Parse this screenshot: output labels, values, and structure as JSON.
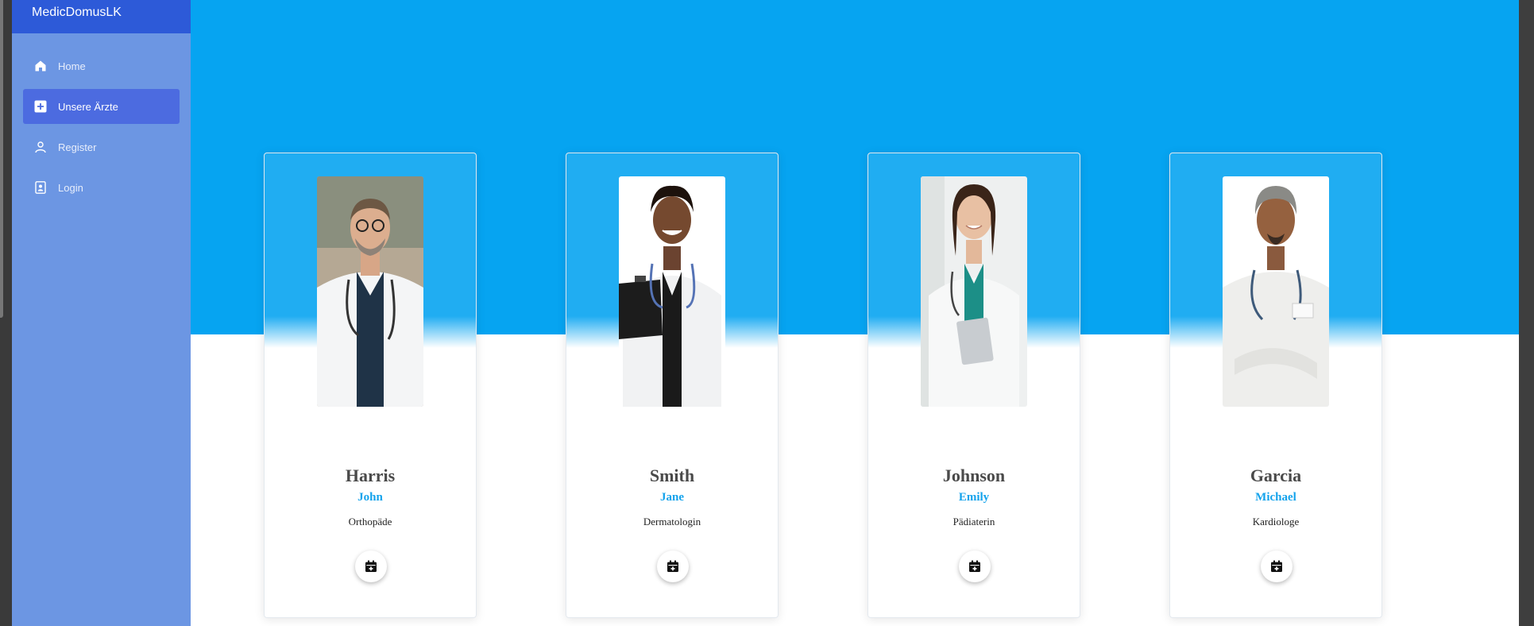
{
  "app": {
    "brand": "MedicDomusLK"
  },
  "sidebar": {
    "items": [
      {
        "label": "Home",
        "icon": "home-icon",
        "active": false
      },
      {
        "label": "Unsere Ärzte",
        "icon": "plus-square-icon",
        "active": true
      },
      {
        "label": "Register",
        "icon": "user-icon",
        "active": false
      },
      {
        "label": "Login",
        "icon": "id-badge-icon",
        "active": false
      }
    ]
  },
  "doctors": [
    {
      "last_name": "Harris",
      "first_name": "John",
      "specialty": "Orthopäde",
      "book_icon": "calendar-plus-icon"
    },
    {
      "last_name": "Smith",
      "first_name": "Jane",
      "specialty": "Dermatologin",
      "book_icon": "calendar-plus-icon"
    },
    {
      "last_name": "Johnson",
      "first_name": "Emily",
      "specialty": "Pädiaterin",
      "book_icon": "calendar-plus-icon"
    },
    {
      "last_name": "Garcia",
      "first_name": "Michael",
      "specialty": "Kardiologe",
      "book_icon": "calendar-plus-icon"
    }
  ],
  "colors": {
    "sidebar_bg": "#6c96e3",
    "brand_bg": "#2d5ad8",
    "active_item_bg": "#4c6be0",
    "hero_bg": "#06a4f1",
    "first_name_color": "#14a3ec"
  }
}
